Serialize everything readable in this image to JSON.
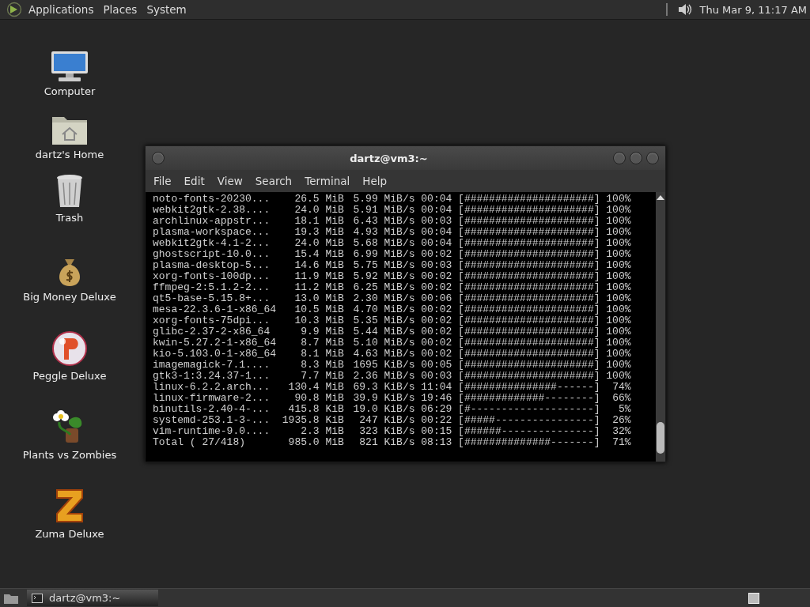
{
  "top_panel": {
    "menus": [
      "Applications",
      "Places",
      "System"
    ],
    "clock": "Thu Mar  9, 11:17 AM"
  },
  "desktop_icons": [
    {
      "kind": "computer",
      "label": "Computer"
    },
    {
      "kind": "home",
      "label": "dartz's Home"
    },
    {
      "kind": "trash",
      "label": "Trash"
    },
    {
      "kind": "money",
      "label": "Big Money Deluxe"
    },
    {
      "kind": "ball",
      "label": "Peggle Deluxe"
    },
    {
      "kind": "flower",
      "label": "Plants vs Zombies"
    },
    {
      "kind": "block",
      "label": "Zuma Deluxe"
    }
  ],
  "window": {
    "title": "dartz@vm3:~",
    "menu": [
      "File",
      "Edit",
      "View",
      "Search",
      "Terminal",
      "Help"
    ],
    "rows": [
      {
        "name": "noto-fonts-20230...",
        "size": "26.5 MiB",
        "rate": "5.99 MiB/s",
        "eta": "00:04",
        "bar": "[#####################]",
        "percent": "100%"
      },
      {
        "name": "webkit2gtk-2.38....",
        "size": "24.0 MiB",
        "rate": "5.91 MiB/s",
        "eta": "00:04",
        "bar": "[#####################]",
        "percent": "100%"
      },
      {
        "name": "archlinux-appstr...",
        "size": "18.1 MiB",
        "rate": "6.43 MiB/s",
        "eta": "00:03",
        "bar": "[#####################]",
        "percent": "100%"
      },
      {
        "name": "plasma-workspace...",
        "size": "19.3 MiB",
        "rate": "4.93 MiB/s",
        "eta": "00:04",
        "bar": "[#####################]",
        "percent": "100%"
      },
      {
        "name": "webkit2gtk-4.1-2...",
        "size": "24.0 MiB",
        "rate": "5.68 MiB/s",
        "eta": "00:04",
        "bar": "[#####################]",
        "percent": "100%"
      },
      {
        "name": "ghostscript-10.0...",
        "size": "15.4 MiB",
        "rate": "6.99 MiB/s",
        "eta": "00:02",
        "bar": "[#####################]",
        "percent": "100%"
      },
      {
        "name": "plasma-desktop-5...",
        "size": "14.6 MiB",
        "rate": "5.75 MiB/s",
        "eta": "00:03",
        "bar": "[#####################]",
        "percent": "100%"
      },
      {
        "name": "xorg-fonts-100dp...",
        "size": "11.9 MiB",
        "rate": "5.92 MiB/s",
        "eta": "00:02",
        "bar": "[#####################]",
        "percent": "100%"
      },
      {
        "name": "ffmpeg-2:5.1.2-2...",
        "size": "11.2 MiB",
        "rate": "6.25 MiB/s",
        "eta": "00:02",
        "bar": "[#####################]",
        "percent": "100%"
      },
      {
        "name": "qt5-base-5.15.8+...",
        "size": "13.0 MiB",
        "rate": "2.30 MiB/s",
        "eta": "00:06",
        "bar": "[#####################]",
        "percent": "100%"
      },
      {
        "name": "mesa-22.3.6-1-x86_64",
        "size": "10.5 MiB",
        "rate": "4.70 MiB/s",
        "eta": "00:02",
        "bar": "[#####################]",
        "percent": "100%"
      },
      {
        "name": "xorg-fonts-75dpi...",
        "size": "10.3 MiB",
        "rate": "5.35 MiB/s",
        "eta": "00:02",
        "bar": "[#####################]",
        "percent": "100%"
      },
      {
        "name": "glibc-2.37-2-x86_64",
        "size": "9.9 MiB",
        "rate": "5.44 MiB/s",
        "eta": "00:02",
        "bar": "[#####################]",
        "percent": "100%"
      },
      {
        "name": "kwin-5.27.2-1-x86_64",
        "size": "8.7 MiB",
        "rate": "5.10 MiB/s",
        "eta": "00:02",
        "bar": "[#####################]",
        "percent": "100%"
      },
      {
        "name": "kio-5.103.0-1-x86_64",
        "size": "8.1 MiB",
        "rate": "4.63 MiB/s",
        "eta": "00:02",
        "bar": "[#####################]",
        "percent": "100%"
      },
      {
        "name": "imagemagick-7.1....",
        "size": "8.3 MiB",
        "rate": "1695 KiB/s",
        "eta": "00:05",
        "bar": "[#####################]",
        "percent": "100%"
      },
      {
        "name": "gtk3-1:3.24.37-1...",
        "size": "7.7 MiB",
        "rate": "2.36 MiB/s",
        "eta": "00:03",
        "bar": "[#####################]",
        "percent": "100%"
      },
      {
        "name": "linux-6.2.2.arch...",
        "size": "130.4 MiB",
        "rate": "69.3 KiB/s",
        "eta": "11:04",
        "bar": "[###############------]",
        "percent": "74%"
      },
      {
        "name": "linux-firmware-2...",
        "size": "90.8 MiB",
        "rate": "39.9 KiB/s",
        "eta": "19:46",
        "bar": "[#############--------]",
        "percent": "66%"
      },
      {
        "name": "binutils-2.40-4-...",
        "size": "415.8 KiB",
        "rate": "19.0 KiB/s",
        "eta": "06:29",
        "bar": "[#--------------------]",
        "percent": "5%"
      },
      {
        "name": "systemd-253.1-3-...",
        "size": "1935.8 KiB",
        "rate": "247 KiB/s",
        "eta": "00:22",
        "bar": "[#####----------------]",
        "percent": "26%"
      },
      {
        "name": "vim-runtime-9.0....",
        "size": "2.3 MiB",
        "rate": "323 KiB/s",
        "eta": "00:15",
        "bar": "[######---------------]",
        "percent": "32%"
      },
      {
        "name": "Total ( 27/418)",
        "size": "985.0 MiB",
        "rate": "821 KiB/s",
        "eta": "08:13",
        "bar": "[##############-------]",
        "percent": "71%"
      }
    ]
  },
  "taskbar": {
    "tasks": [
      {
        "label": "dartz@vm3:~",
        "selected": true
      }
    ]
  }
}
